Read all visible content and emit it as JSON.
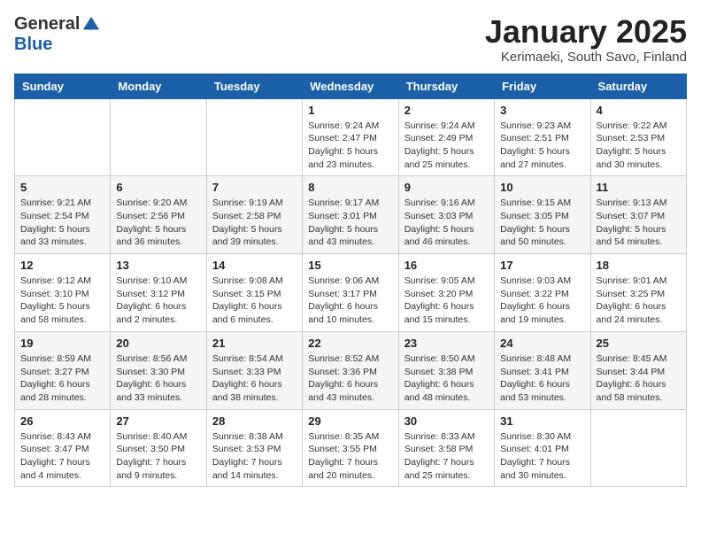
{
  "logo": {
    "general": "General",
    "blue": "Blue"
  },
  "header": {
    "title": "January 2025",
    "subtitle": "Kerimaeki, South Savo, Finland"
  },
  "weekdays": [
    "Sunday",
    "Monday",
    "Tuesday",
    "Wednesday",
    "Thursday",
    "Friday",
    "Saturday"
  ],
  "weeks": [
    [
      {
        "day": "",
        "sunrise": "",
        "sunset": "",
        "daylight": ""
      },
      {
        "day": "",
        "sunrise": "",
        "sunset": "",
        "daylight": ""
      },
      {
        "day": "",
        "sunrise": "",
        "sunset": "",
        "daylight": ""
      },
      {
        "day": "1",
        "sunrise": "Sunrise: 9:24 AM",
        "sunset": "Sunset: 2:47 PM",
        "daylight": "Daylight: 5 hours and 23 minutes."
      },
      {
        "day": "2",
        "sunrise": "Sunrise: 9:24 AM",
        "sunset": "Sunset: 2:49 PM",
        "daylight": "Daylight: 5 hours and 25 minutes."
      },
      {
        "day": "3",
        "sunrise": "Sunrise: 9:23 AM",
        "sunset": "Sunset: 2:51 PM",
        "daylight": "Daylight: 5 hours and 27 minutes."
      },
      {
        "day": "4",
        "sunrise": "Sunrise: 9:22 AM",
        "sunset": "Sunset: 2:53 PM",
        "daylight": "Daylight: 5 hours and 30 minutes."
      }
    ],
    [
      {
        "day": "5",
        "sunrise": "Sunrise: 9:21 AM",
        "sunset": "Sunset: 2:54 PM",
        "daylight": "Daylight: 5 hours and 33 minutes."
      },
      {
        "day": "6",
        "sunrise": "Sunrise: 9:20 AM",
        "sunset": "Sunset: 2:56 PM",
        "daylight": "Daylight: 5 hours and 36 minutes."
      },
      {
        "day": "7",
        "sunrise": "Sunrise: 9:19 AM",
        "sunset": "Sunset: 2:58 PM",
        "daylight": "Daylight: 5 hours and 39 minutes."
      },
      {
        "day": "8",
        "sunrise": "Sunrise: 9:17 AM",
        "sunset": "Sunset: 3:01 PM",
        "daylight": "Daylight: 5 hours and 43 minutes."
      },
      {
        "day": "9",
        "sunrise": "Sunrise: 9:16 AM",
        "sunset": "Sunset: 3:03 PM",
        "daylight": "Daylight: 5 hours and 46 minutes."
      },
      {
        "day": "10",
        "sunrise": "Sunrise: 9:15 AM",
        "sunset": "Sunset: 3:05 PM",
        "daylight": "Daylight: 5 hours and 50 minutes."
      },
      {
        "day": "11",
        "sunrise": "Sunrise: 9:13 AM",
        "sunset": "Sunset: 3:07 PM",
        "daylight": "Daylight: 5 hours and 54 minutes."
      }
    ],
    [
      {
        "day": "12",
        "sunrise": "Sunrise: 9:12 AM",
        "sunset": "Sunset: 3:10 PM",
        "daylight": "Daylight: 5 hours and 58 minutes."
      },
      {
        "day": "13",
        "sunrise": "Sunrise: 9:10 AM",
        "sunset": "Sunset: 3:12 PM",
        "daylight": "Daylight: 6 hours and 2 minutes."
      },
      {
        "day": "14",
        "sunrise": "Sunrise: 9:08 AM",
        "sunset": "Sunset: 3:15 PM",
        "daylight": "Daylight: 6 hours and 6 minutes."
      },
      {
        "day": "15",
        "sunrise": "Sunrise: 9:06 AM",
        "sunset": "Sunset: 3:17 PM",
        "daylight": "Daylight: 6 hours and 10 minutes."
      },
      {
        "day": "16",
        "sunrise": "Sunrise: 9:05 AM",
        "sunset": "Sunset: 3:20 PM",
        "daylight": "Daylight: 6 hours and 15 minutes."
      },
      {
        "day": "17",
        "sunrise": "Sunrise: 9:03 AM",
        "sunset": "Sunset: 3:22 PM",
        "daylight": "Daylight: 6 hours and 19 minutes."
      },
      {
        "day": "18",
        "sunrise": "Sunrise: 9:01 AM",
        "sunset": "Sunset: 3:25 PM",
        "daylight": "Daylight: 6 hours and 24 minutes."
      }
    ],
    [
      {
        "day": "19",
        "sunrise": "Sunrise: 8:59 AM",
        "sunset": "Sunset: 3:27 PM",
        "daylight": "Daylight: 6 hours and 28 minutes."
      },
      {
        "day": "20",
        "sunrise": "Sunrise: 8:56 AM",
        "sunset": "Sunset: 3:30 PM",
        "daylight": "Daylight: 6 hours and 33 minutes."
      },
      {
        "day": "21",
        "sunrise": "Sunrise: 8:54 AM",
        "sunset": "Sunset: 3:33 PM",
        "daylight": "Daylight: 6 hours and 38 minutes."
      },
      {
        "day": "22",
        "sunrise": "Sunrise: 8:52 AM",
        "sunset": "Sunset: 3:36 PM",
        "daylight": "Daylight: 6 hours and 43 minutes."
      },
      {
        "day": "23",
        "sunrise": "Sunrise: 8:50 AM",
        "sunset": "Sunset: 3:38 PM",
        "daylight": "Daylight: 6 hours and 48 minutes."
      },
      {
        "day": "24",
        "sunrise": "Sunrise: 8:48 AM",
        "sunset": "Sunset: 3:41 PM",
        "daylight": "Daylight: 6 hours and 53 minutes."
      },
      {
        "day": "25",
        "sunrise": "Sunrise: 8:45 AM",
        "sunset": "Sunset: 3:44 PM",
        "daylight": "Daylight: 6 hours and 58 minutes."
      }
    ],
    [
      {
        "day": "26",
        "sunrise": "Sunrise: 8:43 AM",
        "sunset": "Sunset: 3:47 PM",
        "daylight": "Daylight: 7 hours and 4 minutes."
      },
      {
        "day": "27",
        "sunrise": "Sunrise: 8:40 AM",
        "sunset": "Sunset: 3:50 PM",
        "daylight": "Daylight: 7 hours and 9 minutes."
      },
      {
        "day": "28",
        "sunrise": "Sunrise: 8:38 AM",
        "sunset": "Sunset: 3:53 PM",
        "daylight": "Daylight: 7 hours and 14 minutes."
      },
      {
        "day": "29",
        "sunrise": "Sunrise: 8:35 AM",
        "sunset": "Sunset: 3:55 PM",
        "daylight": "Daylight: 7 hours and 20 minutes."
      },
      {
        "day": "30",
        "sunrise": "Sunrise: 8:33 AM",
        "sunset": "Sunset: 3:58 PM",
        "daylight": "Daylight: 7 hours and 25 minutes."
      },
      {
        "day": "31",
        "sunrise": "Sunrise: 8:30 AM",
        "sunset": "Sunset: 4:01 PM",
        "daylight": "Daylight: 7 hours and 30 minutes."
      },
      {
        "day": "",
        "sunrise": "",
        "sunset": "",
        "daylight": ""
      }
    ]
  ]
}
